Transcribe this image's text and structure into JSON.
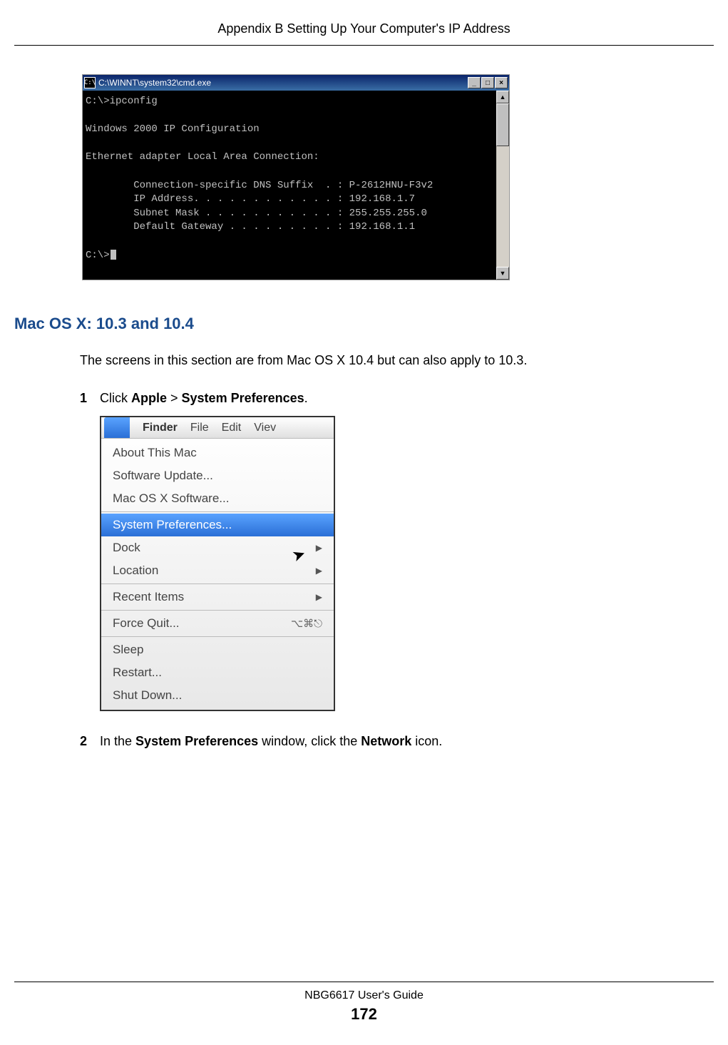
{
  "header": {
    "title": "Appendix B Setting Up Your Computer's IP Address"
  },
  "cmd": {
    "title": "C:\\WINNT\\system32\\cmd.exe",
    "min": "_",
    "max": "□",
    "close": "×",
    "scroll_up": "▲",
    "scroll_down": "▼",
    "lines": {
      "l1": "C:\\>ipconfig",
      "l2": "",
      "l3": "Windows 2000 IP Configuration",
      "l4": "",
      "l5": "Ethernet adapter Local Area Connection:",
      "l6": "",
      "l7": "        Connection-specific DNS Suffix  . : P-2612HNU-F3v2",
      "l8": "        IP Address. . . . . . . . . . . . : 192.168.1.7",
      "l9": "        Subnet Mask . . . . . . . . . . . : 255.255.255.0",
      "l10": "        Default Gateway . . . . . . . . . : 192.168.1.1",
      "l11": "",
      "l12": "C:\\>"
    }
  },
  "section": {
    "heading": "Mac OS X: 10.3 and 10.4",
    "intro": "The screens in this section are from Mac OS X 10.4 but can also apply to 10.3."
  },
  "steps": {
    "s1": {
      "num": "1",
      "pre": "Click ",
      "b1": "Apple",
      "mid": " > ",
      "b2": "System Preferences",
      "post": "."
    },
    "s2": {
      "num": "2",
      "pre": "In the ",
      "b1": "System Preferences",
      "mid": " window, click the ",
      "b2": "Network",
      "post": " icon."
    }
  },
  "mac": {
    "menubar": {
      "finder": "Finder",
      "file": "File",
      "edit": "Edit",
      "view": "Viev"
    },
    "items": {
      "about": "About This Mac",
      "update": "Software Update...",
      "software": "Mac OS X Software...",
      "sysprefs": "System Preferences...",
      "dock": "Dock",
      "location": "Location",
      "recent": "Recent Items",
      "force": "Force Quit...",
      "sleep": "Sleep",
      "restart": "Restart...",
      "shutdown": "Shut Down..."
    },
    "arrow": "▶",
    "shortcut": "⌥⌘⎋"
  },
  "footer": {
    "guide": "NBG6617 User's Guide",
    "page": "172"
  }
}
